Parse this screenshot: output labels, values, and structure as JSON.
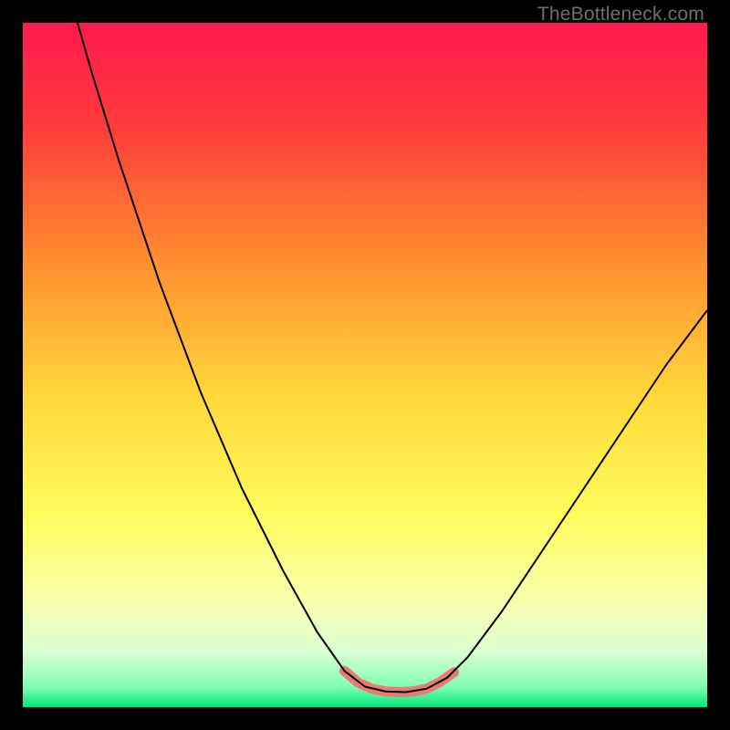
{
  "watermark": "TheBottleneck.com",
  "chart_data": {
    "type": "line",
    "title": "",
    "xlabel": "",
    "ylabel": "",
    "xlim": [
      0,
      100
    ],
    "ylim": [
      0,
      100
    ],
    "grid": false,
    "legend": false,
    "background_gradient": {
      "stops": [
        {
          "pos": 0.0,
          "color": "#ff1a4d"
        },
        {
          "pos": 0.15,
          "color": "#ff3b3b"
        },
        {
          "pos": 0.35,
          "color": "#ff8f2f"
        },
        {
          "pos": 0.55,
          "color": "#ffd93b"
        },
        {
          "pos": 0.72,
          "color": "#fffb5c"
        },
        {
          "pos": 0.85,
          "color": "#f7ffb0"
        },
        {
          "pos": 0.92,
          "color": "#d9ffd0"
        },
        {
          "pos": 0.97,
          "color": "#7fffb0"
        },
        {
          "pos": 1.0,
          "color": "#00e676"
        }
      ]
    },
    "series": [
      {
        "name": "bottleneck-curve",
        "color": "#000000",
        "stroke_width": 2,
        "points": [
          {
            "x": 8.0,
            "y": 100.0
          },
          {
            "x": 10.0,
            "y": 93.0
          },
          {
            "x": 14.0,
            "y": 80.0
          },
          {
            "x": 20.0,
            "y": 62.0
          },
          {
            "x": 26.0,
            "y": 46.0
          },
          {
            "x": 32.0,
            "y": 32.0
          },
          {
            "x": 38.0,
            "y": 20.0
          },
          {
            "x": 43.0,
            "y": 11.0
          },
          {
            "x": 47.0,
            "y": 5.3
          },
          {
            "x": 50.0,
            "y": 3.0
          },
          {
            "x": 53.0,
            "y": 2.3
          },
          {
            "x": 56.0,
            "y": 2.2
          },
          {
            "x": 59.0,
            "y": 2.7
          },
          {
            "x": 62.0,
            "y": 4.3
          },
          {
            "x": 65.0,
            "y": 7.3
          },
          {
            "x": 70.0,
            "y": 14.0
          },
          {
            "x": 76.0,
            "y": 23.0
          },
          {
            "x": 82.0,
            "y": 32.0
          },
          {
            "x": 88.0,
            "y": 41.0
          },
          {
            "x": 94.0,
            "y": 50.0
          },
          {
            "x": 100.0,
            "y": 58.0
          }
        ]
      },
      {
        "name": "optimal-zone-highlight",
        "color": "#e97b72",
        "stroke_width": 11,
        "linecap": "round",
        "points": [
          {
            "x": 47.0,
            "y": 5.3
          },
          {
            "x": 49.0,
            "y": 3.6
          },
          {
            "x": 51.0,
            "y": 2.7
          },
          {
            "x": 53.0,
            "y": 2.3
          },
          {
            "x": 55.0,
            "y": 2.2
          },
          {
            "x": 57.0,
            "y": 2.3
          },
          {
            "x": 59.0,
            "y": 2.7
          },
          {
            "x": 61.0,
            "y": 3.7
          },
          {
            "x": 63.0,
            "y": 5.1
          }
        ]
      }
    ]
  }
}
